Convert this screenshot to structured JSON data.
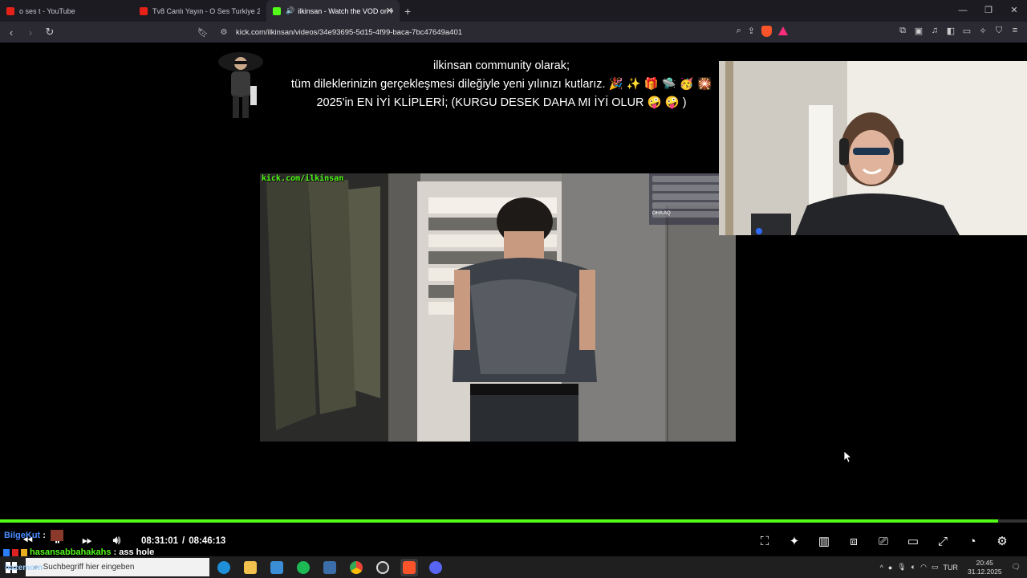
{
  "browser": {
    "tabs": [
      {
        "title": "o ses t - YouTube",
        "favicon": "youtube-icon",
        "active": false
      },
      {
        "title": "Tv8 Canlı Yayın - O Ses Turkiye 2026",
        "favicon": "youtube-icon",
        "active": false
      },
      {
        "title": "ilkinsan - Watch the VOD on K",
        "favicon": "kick-icon",
        "active": true
      }
    ],
    "url": "kick.com/ilkinsan/videos/34e93695-5d15-4f99-baca-7bc47649a401"
  },
  "stream": {
    "overlay_line1": "ilkinsan community olarak;",
    "overlay_line2": "tüm dileklerinizin gerçekleşmesi dileğiyle yeni yılınızı kutlarız. 🎉 ✨ 🎁 🛸 🥳 🎇",
    "overlay_line3": "2025'in EN İYİ KLİPLERİ; (KURGU DESEK DAHA MI İYİ OLUR 🤪 🤪 )",
    "clip_watermark": "kick.com/ilkinsan",
    "clip_chat_line": "OHA AQ"
  },
  "player": {
    "current_time": "08:31:01",
    "separator": "/",
    "duration": "08:46:13",
    "progress_fraction": 0.9716,
    "accent": "#53fc18"
  },
  "chat": {
    "line1_user": "BilgeKut",
    "line1_sep": ":",
    "line2_user": "hasansabbahakahs",
    "line2_text": ": ass hole",
    "ghost_text": "hazemorn"
  },
  "taskbar": {
    "search_placeholder": "Suchbegriff hier eingeben",
    "language": "TUR",
    "time": "20:45",
    "date": "31.12.2025"
  }
}
